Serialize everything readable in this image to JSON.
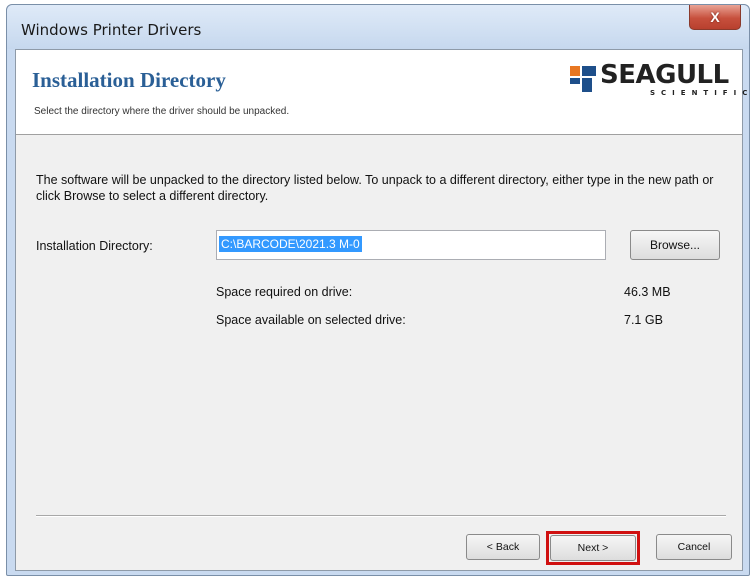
{
  "window": {
    "title": "Windows Printer Drivers",
    "close_label": "X"
  },
  "header": {
    "title": "Installation Directory",
    "subtitle": "Select the directory where the driver should be unpacked.",
    "logo_text": "SEAGULL",
    "logo_subtext": "SCIENTIFIC"
  },
  "body": {
    "description": "The software will be unpacked to the directory listed below.  To unpack to a different directory, either type in the new path or click Browse to select a different directory.",
    "install_dir_label": "Installation Directory:",
    "install_dir_value": "C:\\BARCODE\\2021.3 M-0",
    "browse_label": "Browse...",
    "space_required_label": "Space required on drive:",
    "space_required_value": "46.3 MB",
    "space_available_label": "Space available on selected drive:",
    "space_available_value": "7.1 GB"
  },
  "footer": {
    "back_label": "< Back",
    "next_label": "Next >",
    "cancel_label": "Cancel"
  },
  "colors": {
    "header_title": "#2a5f96",
    "highlight_box": "#d01010",
    "selection": "#3399ff"
  }
}
